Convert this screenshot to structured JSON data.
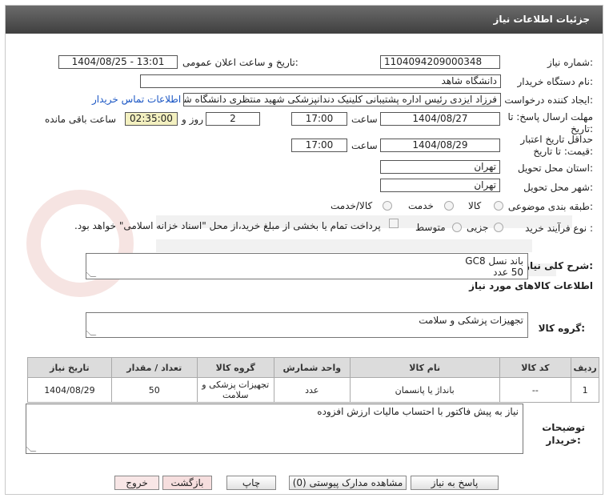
{
  "header": {
    "title": "جزئیات اطلاعات نیاز"
  },
  "form": {
    "need_number_label": "شماره نیاز:",
    "need_number": "1104094209000348",
    "announce_label": "تاریخ و ساعت اعلان عمومی:",
    "announce_value": "1404/08/25 - 13:01",
    "buyer_org_label": "نام دستگاه خریدار:",
    "buyer_org": "دانشگاه شاهد",
    "requester_label": "ایجاد کننده درخواست:",
    "requester": "فرزاد ایزدی رئیس اداره پشتیبانی کلینیک دندانپزشکی شهید منتظری دانشگاه شاهد",
    "contact_link": "اطلاعات تماس خریدار",
    "deadline_label_1": "مهلت ارسال پاسخ: تا",
    "deadline_label_2": "تاریخ:",
    "deadline_date": "1404/08/27",
    "time_label": "ساعت",
    "deadline_time": "17:00",
    "days_value": "2",
    "days_label": "روز و",
    "remaining_time": "02:35:00",
    "remaining_label": "ساعت باقی مانده",
    "validity_label_1": "حداقل تاریخ اعتبار",
    "validity_label_2": "قیمت: تا تاریخ:",
    "validity_date": "1404/08/29",
    "validity_time": "17:00",
    "province_label": "استان محل تحویل:",
    "province": "تهران",
    "city_label": "شهر محل تحویل:",
    "city": "تهران",
    "category_label": "طبقه بندی موضوعی:",
    "category_options": [
      "کالا",
      "خدمت",
      "کالا/خدمت"
    ],
    "process_label": "نوع فرآیند خرید :",
    "process_options": [
      "جزیی",
      "متوسط"
    ],
    "payment_note": "پرداخت تمام یا بخشی از مبلغ خرید،از محل \"اسناد خزانه اسلامی\" خواهد بود.",
    "summary_label": "شرح کلی نیاز:",
    "summary_line1": "باند نسل GC8",
    "summary_line2": "50 عدد",
    "goods_info_title": "اطلاعات کالاهای مورد نیاز",
    "goods_group_label": "گروه کالا:",
    "goods_group": "تجهیزات پزشکی و سلامت",
    "buyer_notes_label_1": "توضیحات",
    "buyer_notes_label_2": "خریدار:",
    "buyer_notes": "نیاز به پیش فاکتور با احتساب مالیات ارزش افزوده"
  },
  "table": {
    "headers": [
      "ردیف",
      "کد کالا",
      "نام کالا",
      "واحد شمارش",
      "گروه کالا",
      "تعداد / مقدار",
      "تاریخ نیاز"
    ],
    "rows": [
      [
        "1",
        "--",
        "بانداژ یا پانسمان",
        "عدد",
        "تجهیزات پزشکی و سلامت",
        "50",
        "1404/08/29"
      ]
    ]
  },
  "buttons": {
    "reply": "پاسخ به نیاز",
    "docs": "مشاهده مدارک پیوستی (0)",
    "print": "چاپ",
    "back": "بازگشت",
    "exit": "خروج"
  },
  "colors": {
    "title_bar": "#4f4f4f",
    "link": "#1a56c4",
    "remaining_bg": "#f3f0c0",
    "back_btn_bg": "#f6dede",
    "exit_btn_bg": "#f8e6e6"
  }
}
